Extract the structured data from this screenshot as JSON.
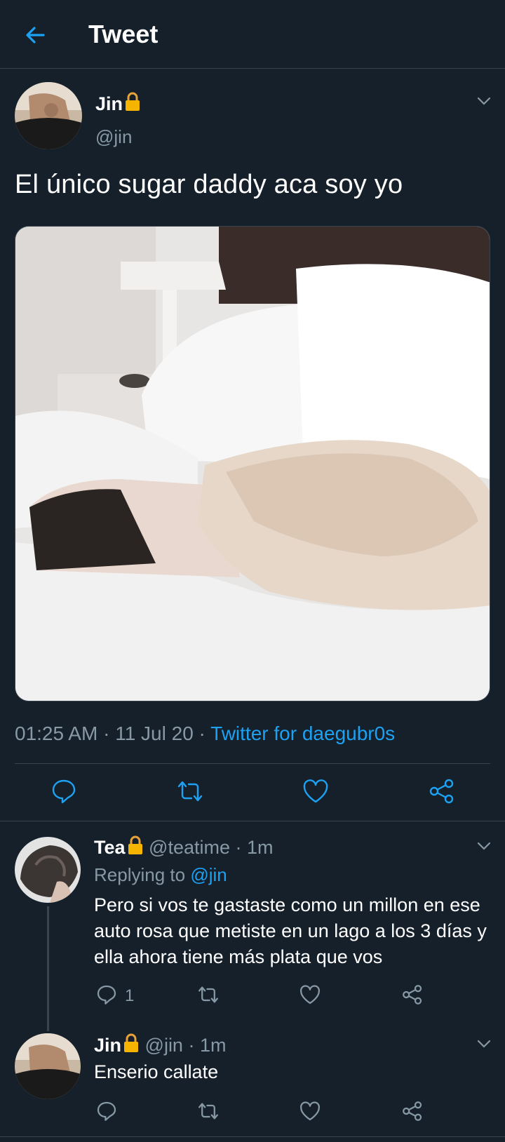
{
  "header": {
    "title": "Tweet",
    "back_icon": "back-arrow-icon"
  },
  "colors": {
    "background": "#15202b",
    "accent": "#1da1f2",
    "muted": "#8899a6",
    "divider": "#38444d"
  },
  "tweet": {
    "author_name": "Jin",
    "author_handle": "@jin",
    "text": "El único sugar daddy aca soy yo",
    "time": "01:25 AM",
    "date": "11 Jul 20",
    "dot": "·",
    "source": "Twitter for daegubr0s",
    "actions": [
      "reply-icon",
      "retweet-icon",
      "like-icon",
      "share-icon"
    ]
  },
  "replies": [
    {
      "name": "Tea",
      "handle": "@teatime",
      "time": "1m",
      "replying_label": "Replying to",
      "replying_to": "@jin",
      "text": "Pero si vos te gastaste como un millon en ese auto rosa que metiste en un lago a los 3 días y ella ahora tiene más plata que vos",
      "reply_count": "1"
    },
    {
      "name": "Jin",
      "handle": "@jin",
      "time": "1m",
      "text": "Enserio callate"
    }
  ]
}
